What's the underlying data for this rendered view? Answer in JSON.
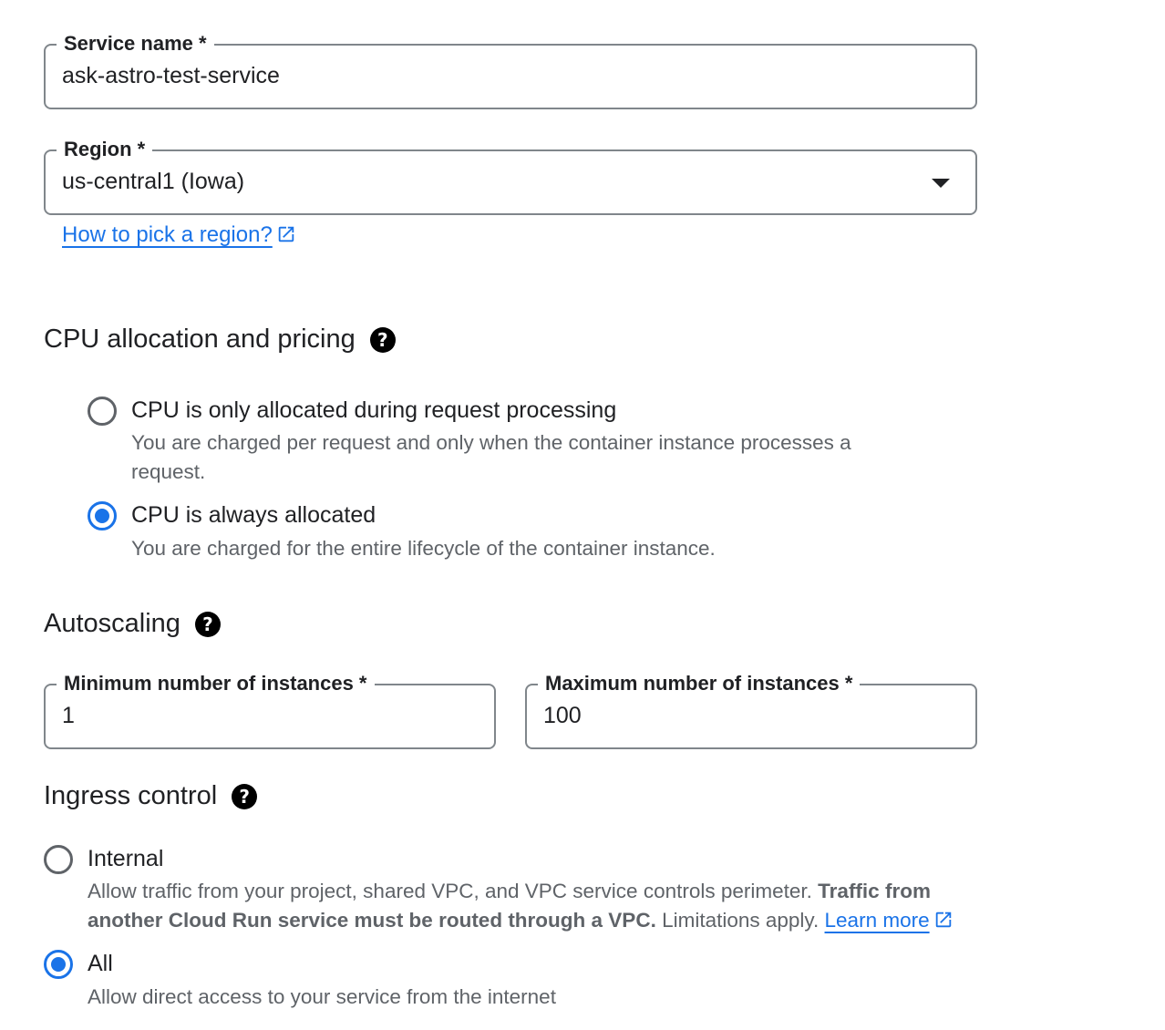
{
  "service_name": {
    "label": "Service name *",
    "value": "ask-astro-test-service"
  },
  "region": {
    "label": "Region *",
    "value": "us-central1 (Iowa)",
    "help_link": "How to pick a region?"
  },
  "cpu": {
    "heading": "CPU allocation and pricing",
    "options": [
      {
        "label": "CPU is only allocated during request processing",
        "description": "You are charged per request and only when the container instance processes a request.",
        "selected": false
      },
      {
        "label": "CPU is always allocated",
        "description": "You are charged for the entire lifecycle of the container instance.",
        "selected": true
      }
    ]
  },
  "autoscaling": {
    "heading": "Autoscaling",
    "min": {
      "label": "Minimum number of instances *",
      "value": "1"
    },
    "max": {
      "label": "Maximum number of instances *",
      "value": "100"
    }
  },
  "ingress": {
    "heading": "Ingress control",
    "internal": {
      "label": "Internal",
      "desc_part1": "Allow traffic from your project, shared VPC, and VPC service controls perimeter.",
      "desc_bold": "Traffic from another Cloud Run service must be routed through a VPC.",
      "desc_part2": "Limitations apply.",
      "learn_more": "Learn more",
      "selected": false
    },
    "all": {
      "label": "All",
      "description": "Allow direct access to your service from the internet",
      "selected": true
    }
  },
  "colors": {
    "accent": "#1a73e8",
    "border": "#80868b",
    "text": "#202124",
    "secondary_text": "#5f6368"
  },
  "icons": {
    "help": "help-circle-icon",
    "external": "open-in-new-icon",
    "dropdown": "arrow-drop-down-icon"
  }
}
